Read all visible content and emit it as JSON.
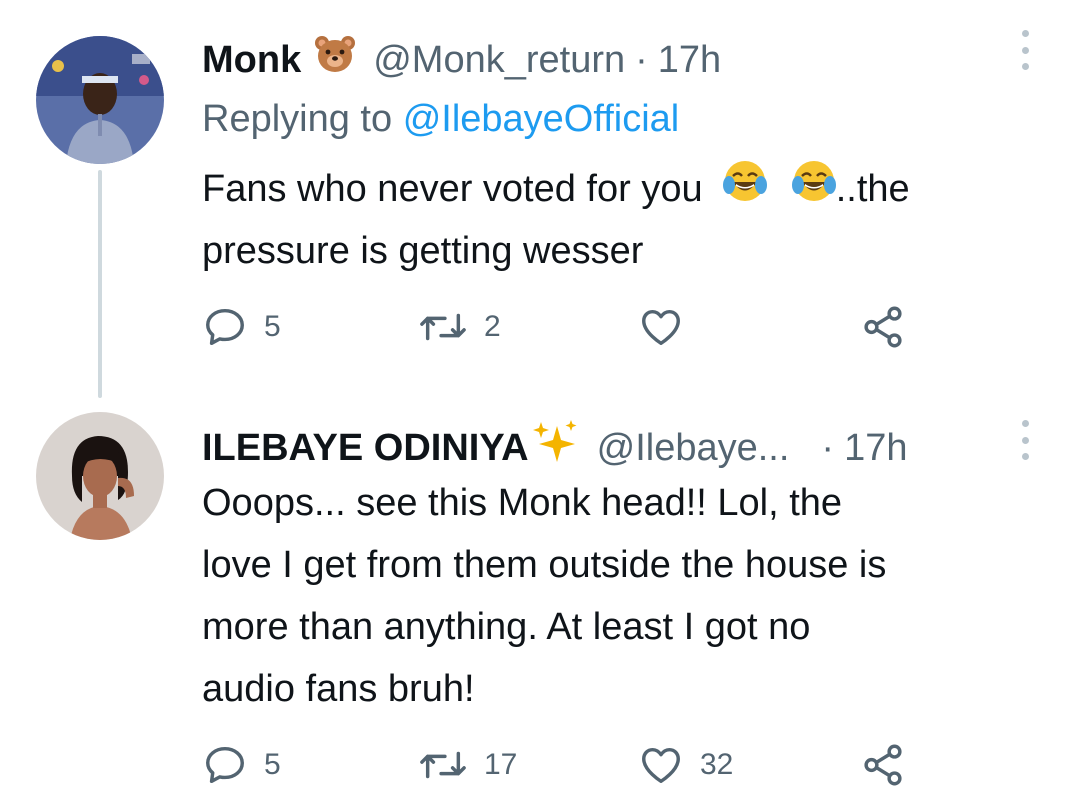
{
  "tweets": [
    {
      "name": "Monk",
      "name_emoji": "bear-face-emoji",
      "handle": "@Monk_return",
      "separator": "·",
      "time": "17h",
      "replying_prefix": "Replying to",
      "replying_handle": "@IlebayeOfficial",
      "body_line1_a": "Fans who never voted for you",
      "body_line1_b": "..the",
      "body_emoji": "face-with-tears-of-joy-emoji",
      "body_line2": "pressure is getting wesser",
      "replies": "5",
      "retweets": "2",
      "likes": ""
    },
    {
      "name": "ILEBAYE ODINIYA",
      "name_emoji": "sparkles-emoji",
      "handle": "@Ilebaye...",
      "separator": "·",
      "time": "17h",
      "body_lines": [
        "Ooops... see this Monk head!! Lol, the",
        "love I get from them outside the house is",
        "more than anything. At least I got no",
        "audio fans bruh!"
      ],
      "replies": "5",
      "retweets": "17",
      "likes": "32"
    }
  ],
  "colors": {
    "text": "#0f1419",
    "secondary": "#536471",
    "link": "#1d9bf0",
    "thread_line": "#cfd9de"
  },
  "icons": [
    "reply-icon",
    "retweet-icon",
    "like-icon",
    "share-icon",
    "more-options-icon"
  ]
}
